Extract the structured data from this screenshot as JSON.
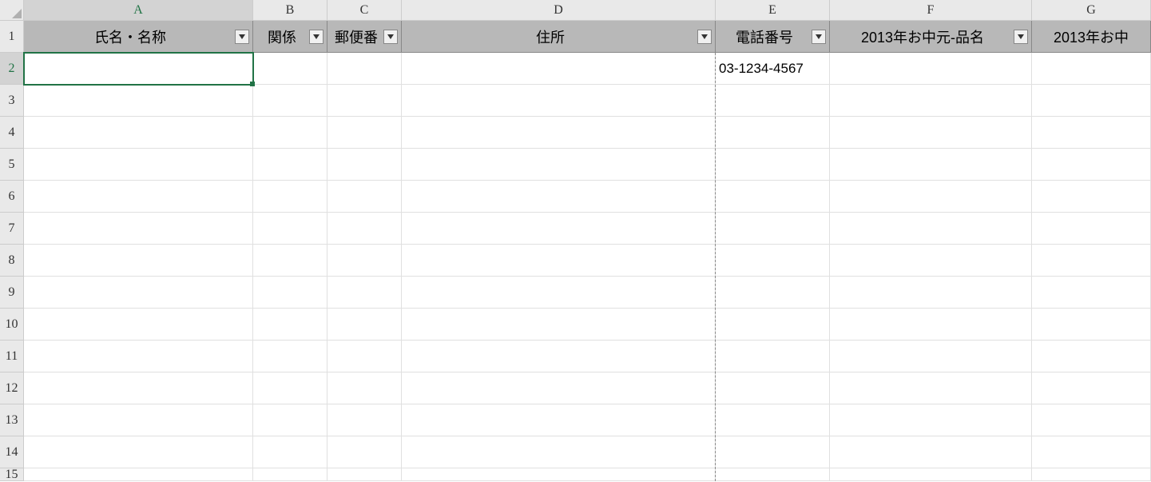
{
  "columns": {
    "a": "A",
    "b": "B",
    "c": "C",
    "d": "D",
    "e": "E",
    "f": "F",
    "g": "G"
  },
  "rows": [
    "1",
    "2",
    "3",
    "4",
    "5",
    "6",
    "7",
    "8",
    "9",
    "10",
    "11",
    "12",
    "13",
    "14",
    "15"
  ],
  "headers": {
    "a": "氏名・名称",
    "b": "関係",
    "c": "郵便番",
    "d": "住所",
    "e": "電話番号",
    "f": "2013年お中元-品名",
    "g": "2013年お中"
  },
  "data": {
    "r2": {
      "e": "03-1234-4567"
    }
  }
}
